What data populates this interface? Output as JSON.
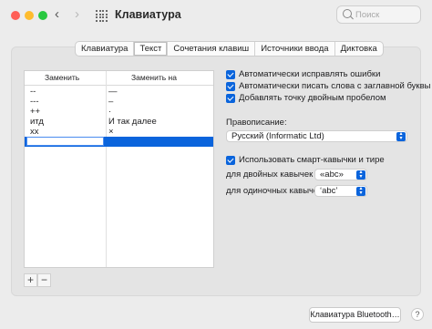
{
  "window": {
    "title": "Клавиатура",
    "search_placeholder": "Поиск"
  },
  "tabs": [
    "Клавиатура",
    "Текст",
    "Сочетания клавиш",
    "Источники ввода",
    "Диктовка"
  ],
  "active_tab": "Текст",
  "table": {
    "headers": [
      "Заменить",
      "Заменить на"
    ],
    "rows": [
      {
        "replace": "--",
        "with": "—"
      },
      {
        "replace": "---",
        "with": "–"
      },
      {
        "replace": "++",
        "with": "·"
      },
      {
        "replace": "итд",
        "with": "И так далее"
      },
      {
        "replace": "xx",
        "with": "×"
      }
    ],
    "add_label": "+",
    "remove_label": "−"
  },
  "options": {
    "autocorrect": "Автоматически исправлять ошибки",
    "capitalize": "Автоматически писать слова с заглавной буквы",
    "double_space": "Добавлять точку двойным пробелом",
    "spelling_label": "Правописание:",
    "spelling_value": "Русский (Informatic Ltd)",
    "smart_quotes": "Использовать смарт-кавычки и тире",
    "double_quotes_label": "для двойных кавычек",
    "double_quotes_value": "«abc»",
    "single_quotes_label": "для одиночных кавычек",
    "single_quotes_value": "‘abc’"
  },
  "footer": {
    "bluetooth_button": "Клавиатура Bluetooth…",
    "help": "?"
  },
  "colors": {
    "accent": "#0a64dc",
    "red": "#ff5f57",
    "yellow": "#febc2e",
    "green": "#28c840"
  }
}
